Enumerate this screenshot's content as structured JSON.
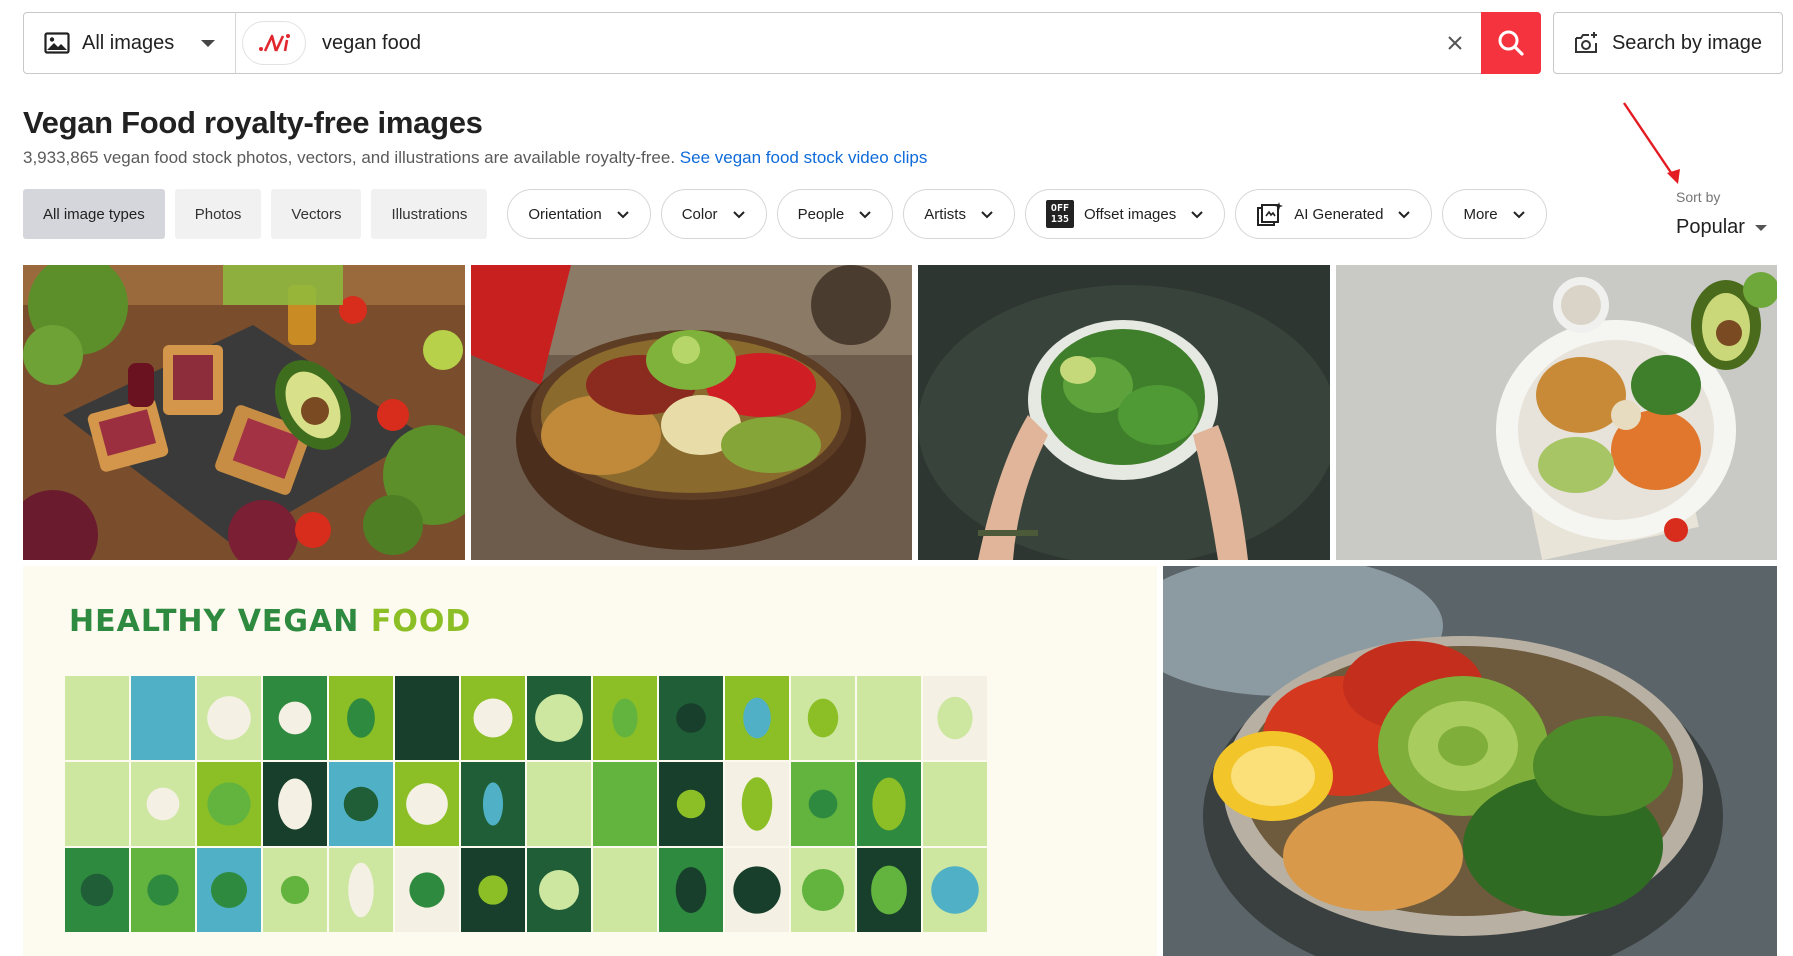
{
  "search": {
    "type_label": "All images",
    "query": "vegan food",
    "search_by_image_label": "Search by image"
  },
  "heading": {
    "title": "Vegan Food royalty-free images",
    "subtitle": "3,933,865 vegan food stock photos, vectors, and illustrations are available royalty-free.",
    "video_link": "See vegan food stock video clips"
  },
  "filters": {
    "types": [
      "All image types",
      "Photos",
      "Vectors",
      "Illustrations"
    ],
    "active_type": "All image types",
    "pills": [
      "Orientation",
      "Color",
      "People",
      "Artists",
      "Offset images",
      "AI Generated",
      "More"
    ],
    "offset_icon_text": [
      "OFF",
      "135"
    ]
  },
  "sort": {
    "label": "Sort by",
    "value": "Popular"
  },
  "images": [
    {
      "subject": "vegan toasts, avocado, tomatoes, beets and broccoli on slate"
    },
    {
      "subject": "coconut bowl with chickpeas, sun-dried tomatoes and sprouts"
    },
    {
      "subject": "hands holding bowl of greens and avocado"
    },
    {
      "subject": "plate with avocado, chickpeas, sweet potato and greens on gray"
    },
    {
      "subject": "illustration banner",
      "banner_title_a": "HEALTHY VEGAN",
      "banner_title_b": "FOOD"
    },
    {
      "subject": "buddha bowl with avocado rose, tomatoes, chickpeas, broccoli, lemon"
    }
  ],
  "colors": {
    "search_red": "#f5333f",
    "link_blue": "#0f6bd9",
    "banner_green": "#2e8a3e",
    "banner_yellow_green": "#8cbf26"
  }
}
